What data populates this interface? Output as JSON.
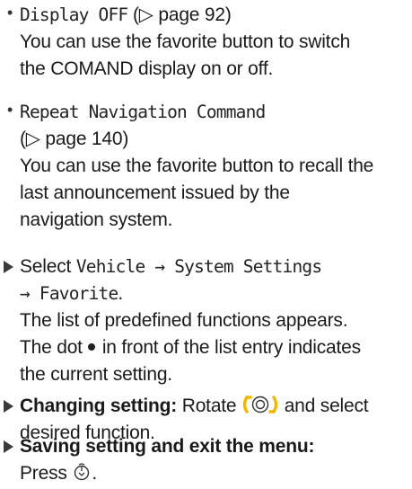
{
  "items": [
    {
      "term": "Display OFF",
      "ref": "(▷ page 92)",
      "desc_lines": [
        "You can use the favorite button to switch",
        "the COMAND display on or off."
      ]
    },
    {
      "term": "Repeat Navigation Command",
      "ref": "(▷ page 140)",
      "desc_lines": [
        "You can use the favorite button to recall the",
        "last announcement issued by the",
        "navigation system."
      ]
    }
  ],
  "steps": {
    "select": {
      "prefix": "Select",
      "path1": "Vehicle → System Settings",
      "path2": "→ Favorite",
      "period": ".",
      "line2": "The list of predefined functions appears.",
      "line3a": "The dot",
      "line3b": "in front of the list entry indicates",
      "line4": "the current setting."
    },
    "changing": {
      "label": "Changing setting:",
      "text_a": "Rotate",
      "text_b": "and select",
      "line2": "desired function."
    },
    "saving": {
      "label": "Saving setting and exit the menu:",
      "text_a": "Press",
      "period": "."
    }
  },
  "colors": {
    "text": "#1a1a1a",
    "knob_accent": "#f2b705",
    "step_marker": "#3a3a3a"
  },
  "icons": [
    "bullet-dot",
    "step-triangle",
    "controller-knob-icon",
    "selection-dot-icon",
    "press-controller-icon"
  ]
}
